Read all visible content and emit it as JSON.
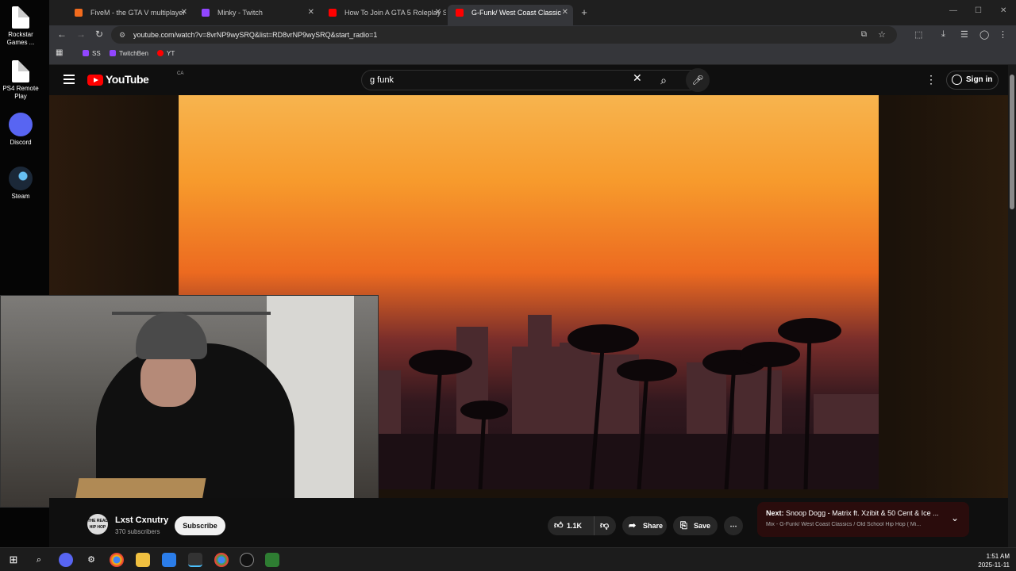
{
  "desktop": {
    "icons": [
      {
        "label": "Rockstar Games ...",
        "icon": "rockstar-icon"
      },
      {
        "label": "PS4 Remote Play",
        "icon": "ps4-icon"
      },
      {
        "label": "Discord",
        "icon": "discord-icon"
      },
      {
        "label": "Steam",
        "icon": "steam-icon"
      }
    ]
  },
  "browser": {
    "tabs": [
      {
        "title": "FiveM - the GTA V multiplayer",
        "active": false
      },
      {
        "title": "Minky - Twitch",
        "active": false
      },
      {
        "title": "How To Join A GTA 5 Roleplay S",
        "active": false
      },
      {
        "title": "G-Funk/ West Coast Classic",
        "active": true
      }
    ],
    "new_tab": "+",
    "url": "youtube.com/watch?v=8vrNP9wySRQ&list=RD8vrNP9wySRQ&start_radio=1",
    "bookmarks": [
      {
        "label": "SS",
        "color": "#9146ff"
      },
      {
        "label": "TwitchBen",
        "color": "#9146ff"
      },
      {
        "label": "YT",
        "color": "#ff0000"
      }
    ]
  },
  "youtube": {
    "logo_text": "YouTube",
    "country": "CA",
    "search_value": "g funk",
    "sign_in": "Sign in"
  },
  "video": {
    "channel_name": "Lxst Cxnutry",
    "channel_avatar_text": "THE REAL HIP HOP",
    "subscribers": "370 subscribers",
    "subscribe_label": "Subscribe",
    "likes": "1.1K",
    "share_label": "Share",
    "save_label": "Save"
  },
  "up_next": {
    "prefix": "Next:",
    "title": "Snoop Dogg - Matrix ft. Xzibit & 50 Cent & Ice ...",
    "subtitle": "Mix - G-Funk/ West Coast Classics / Old School Hip Hop ( Mi..."
  },
  "taskbar": {
    "time": "1:51 AM",
    "date": "2025-11-11"
  },
  "colors": {
    "youtube_red": "#ff0000",
    "background": "#0f0f0f",
    "next_card": "#2a0c0c"
  }
}
